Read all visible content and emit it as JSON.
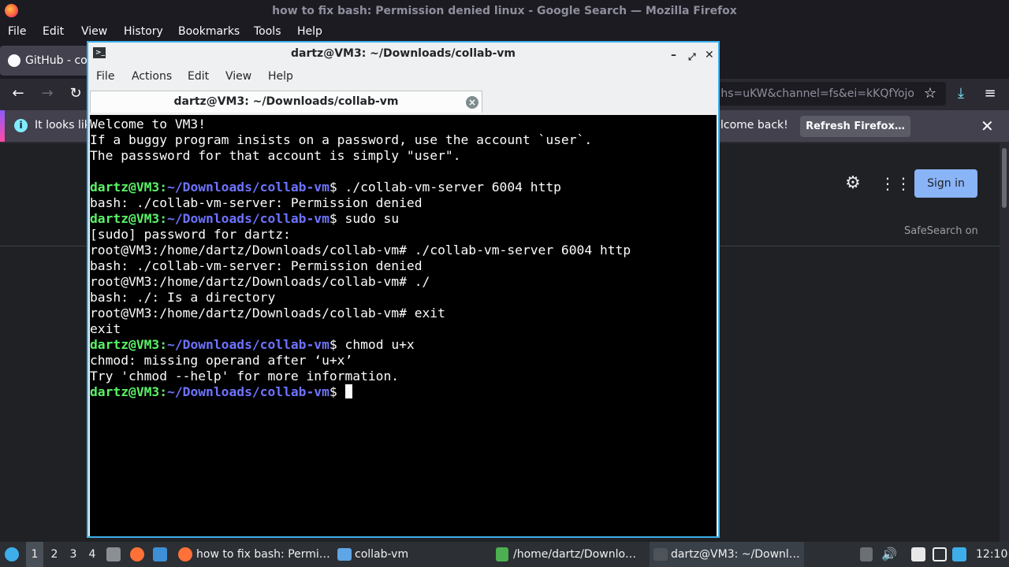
{
  "firefox": {
    "title": "how to fix bash: Permission denied linux - Google Search — Mozilla Firefox",
    "menu": [
      "File",
      "Edit",
      "View",
      "History",
      "Bookmarks",
      "Tools",
      "Help"
    ],
    "tab_label": "GitHub - cor",
    "url_visible": "hs=uKW&channel=fs&ei=kKQfYojo",
    "notification": {
      "text_left": "It looks lik",
      "text_right": "lcome back!",
      "button": "Refresh Firefox…"
    },
    "page": {
      "signin": "Sign in",
      "safesearch": "SafeSearch on"
    }
  },
  "terminal": {
    "title": "dartz@VM3: ~/Downloads/collab-vm",
    "menu": [
      "File",
      "Actions",
      "Edit",
      "View",
      "Help"
    ],
    "tab_label": "dartz@VM3: ~/Downloads/collab-vm",
    "lines": [
      {
        "type": "text",
        "text": "Welcome to VM3!"
      },
      {
        "type": "text",
        "text": "If a buggy program insists on a password, use the account `user`."
      },
      {
        "type": "text",
        "text": "The passsword for that account is simply \"user\"."
      },
      {
        "type": "text",
        "text": ""
      },
      {
        "type": "prompt",
        "user": "dartz@VM3",
        "path": "~/Downloads/collab-vm",
        "cmd": "$ ./collab-vm-server 6004 http"
      },
      {
        "type": "text",
        "text": "bash: ./collab-vm-server: Permission denied"
      },
      {
        "type": "prompt",
        "user": "dartz@VM3",
        "path": "~/Downloads/collab-vm",
        "cmd": "$ sudo su"
      },
      {
        "type": "text",
        "text": "[sudo] password for dartz:"
      },
      {
        "type": "text",
        "text": "root@VM3:/home/dartz/Downloads/collab-vm# ./collab-vm-server 6004 http"
      },
      {
        "type": "text",
        "text": "bash: ./collab-vm-server: Permission denied"
      },
      {
        "type": "text",
        "text": "root@VM3:/home/dartz/Downloads/collab-vm# ./"
      },
      {
        "type": "text",
        "text": "bash: ./: Is a directory"
      },
      {
        "type": "text",
        "text": "root@VM3:/home/dartz/Downloads/collab-vm# exit"
      },
      {
        "type": "text",
        "text": "exit"
      },
      {
        "type": "prompt",
        "user": "dartz@VM3",
        "path": "~/Downloads/collab-vm",
        "cmd": "$ chmod u+x"
      },
      {
        "type": "text",
        "text": "chmod: missing operand after ‘u+x’"
      },
      {
        "type": "text",
        "text": "Try 'chmod --help' for more information."
      },
      {
        "type": "prompt",
        "user": "dartz@VM3",
        "path": "~/Downloads/collab-vm",
        "cmd": "$ ",
        "cursor": true
      }
    ]
  },
  "taskbar": {
    "workspaces": [
      "1",
      "2",
      "3",
      "4"
    ],
    "windows": [
      "how to fix bash: Permi…",
      "collab-vm",
      "/home/dartz/Downlo…",
      "dartz@VM3: ~/Downl…"
    ],
    "clock": "12:10"
  },
  "colors": {
    "accent": "#3daee9",
    "prompt_user": "#5af267",
    "prompt_path": "#6e73ff",
    "signin_bg": "#8ab4f8"
  }
}
